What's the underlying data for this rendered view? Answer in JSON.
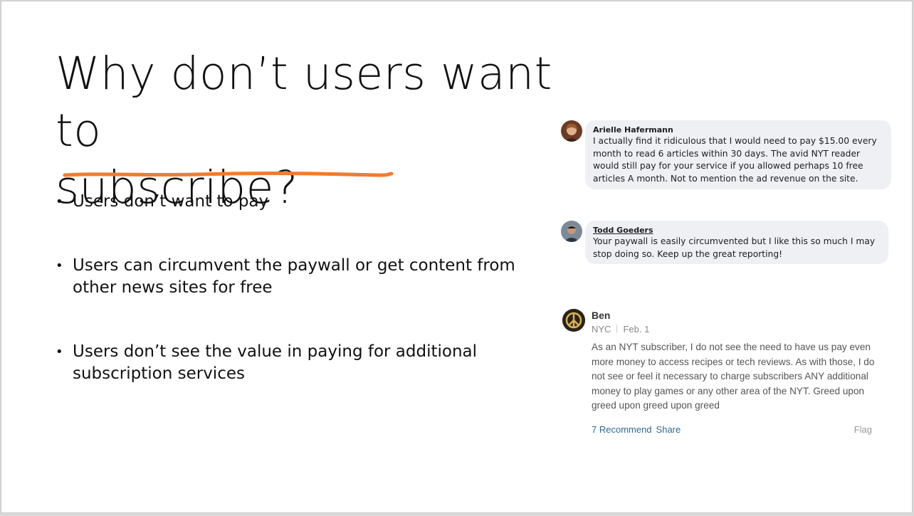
{
  "slide": {
    "title_line1": "Why don’t users want to",
    "title_line2": "subscribe?",
    "accent_color": "#ed7d31",
    "bullets": [
      "Users don’t want to pay",
      "Users can circumvent the paywall or get content from other news sites for free",
      "Users don’t see the value in paying for additional subscription services"
    ],
    "bullet_glyph": "•"
  },
  "comments": {
    "arielle": {
      "name": "Arielle Hafermann",
      "text": "I actually find it ridiculous that I would need to pay $15.00 every month to read 6 articles within 30 days. The avid NYT reader would still pay for your service if you allowed perhaps 10 free articles A month. Not to mention the ad revenue on the site."
    },
    "todd": {
      "name": "Todd Goeders",
      "text": "Your paywall is easily circumvented but I like this so much I may stop doing so. Keep up the great reporting!"
    },
    "ben": {
      "name": "Ben",
      "location": "NYC",
      "date": "Feb. 1",
      "text": "As an NYT subscriber, I do not see the need to have us pay even more money to access recipes or tech reviews. As with those, I do not see or feel it necessary to charge subscribers ANY additional money to play games or any other area of the NYT. Greed upon greed upon greed upon greed",
      "recommend": "7 Recommend",
      "share": "Share",
      "flag": "Flag"
    }
  }
}
